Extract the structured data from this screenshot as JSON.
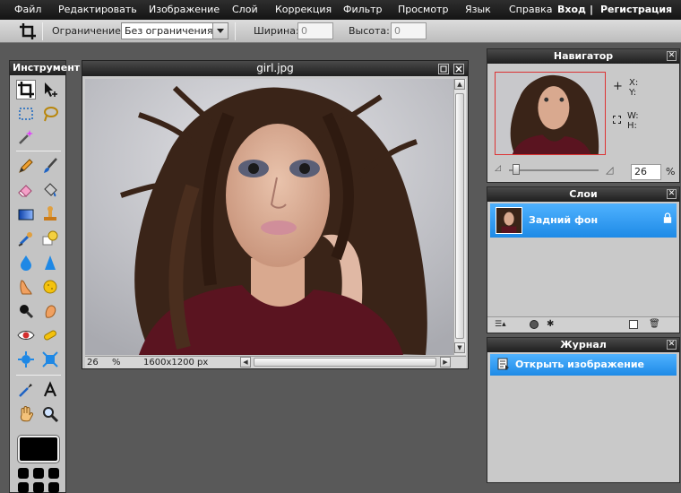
{
  "menu": {
    "items": [
      "Файл",
      "Редактировать",
      "Изображение",
      "Слой",
      "Коррекция",
      "Фильтр",
      "Просмотр",
      "Язык",
      "Справка"
    ],
    "login": "Вход",
    "divider": "|",
    "register": "Регистрация"
  },
  "options": {
    "constraint_label": "Ограничение:",
    "constraint_value": "Без ограничения",
    "width_label": "Ширина:",
    "width_value": "0",
    "height_label": "Высота:",
    "height_value": "0"
  },
  "tools": {
    "title": "Инструмент",
    "icons": [
      "crop-icon",
      "move-icon",
      "marquee-select-icon",
      "lasso-icon",
      "magic-wand-icon",
      "pencil-icon",
      "brush-icon",
      "eraser-icon",
      "paint-bucket-icon",
      "gradient-icon",
      "clone-stamp-icon",
      "color-replace-icon",
      "drawing-icon",
      "blur-icon",
      "sharpen-icon",
      "smudge-icon",
      "sponge-icon",
      "burn-icon",
      "dodge-icon",
      "red-eye-icon",
      "spot-heal-icon",
      "bloat-icon",
      "pinch-icon",
      "color-picker-icon",
      "type-icon",
      "hand-icon",
      "zoom-icon"
    ]
  },
  "image_window": {
    "title": "girl.jpg",
    "zoom": "26",
    "zoom_unit": "%",
    "size": "1600x1200 px"
  },
  "navigator": {
    "title": "Навигатор",
    "x_label": "X:",
    "y_label": "Y:",
    "w_label": "W:",
    "h_label": "H:",
    "zoom": "26",
    "zoom_unit": "%"
  },
  "layers": {
    "title": "Слои",
    "items": [
      {
        "name": "Задний фон"
      }
    ]
  },
  "journal": {
    "title": "Журнал",
    "items": [
      {
        "name": "Открыть изображение"
      }
    ]
  },
  "colors": {
    "menubar": "#1e1e1e",
    "selection": "#2a95f0",
    "workspace": "#595959"
  }
}
